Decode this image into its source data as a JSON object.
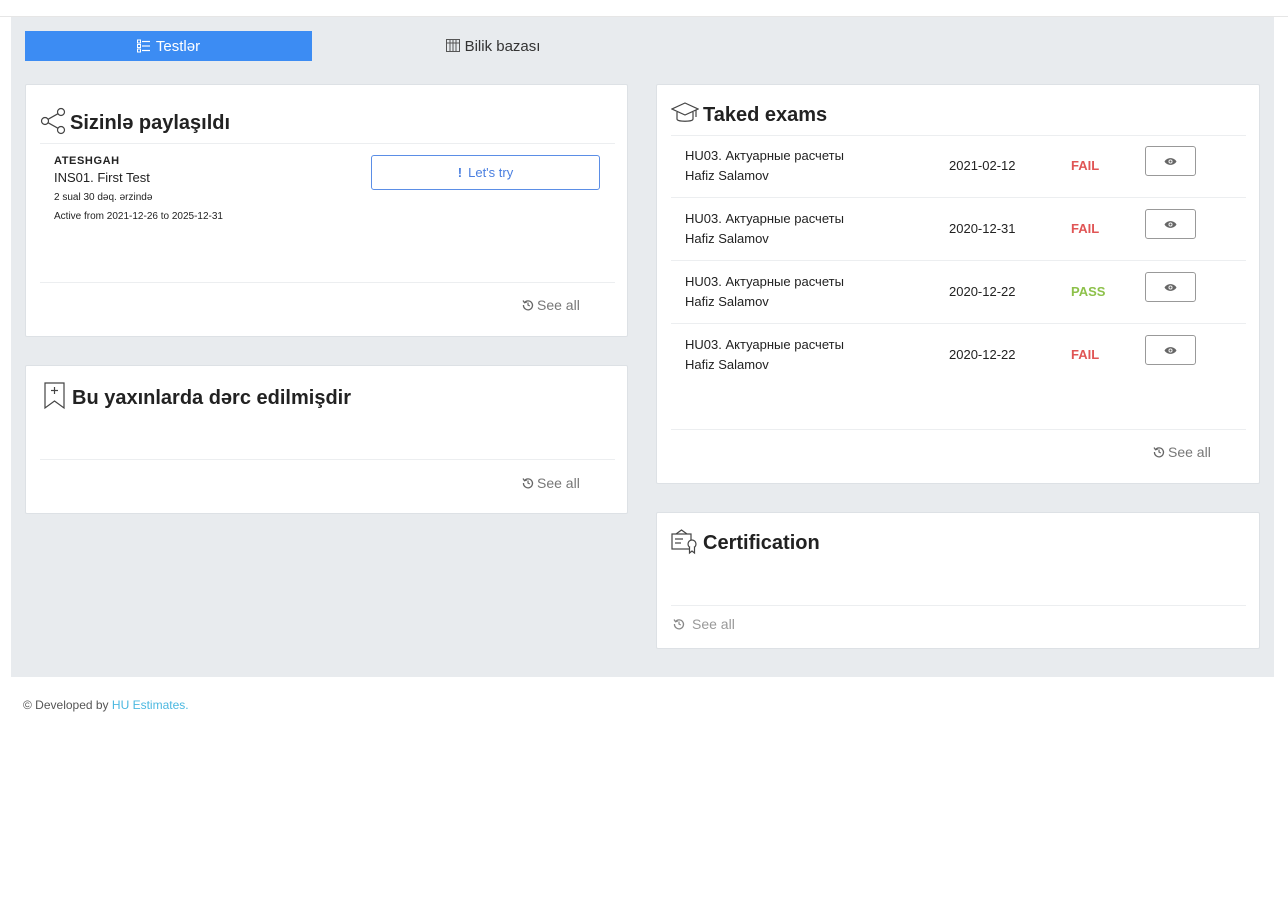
{
  "tabs": [
    {
      "label": "Testlər",
      "icon": "list-icon",
      "active": true
    },
    {
      "label": "Bilik bazası",
      "icon": "library-icon",
      "active": false
    }
  ],
  "shared": {
    "title": "Sizinlə paylaşıldı",
    "icon": "share-icon",
    "item": {
      "org": "ATESHGAH",
      "name": "INS01. First Test",
      "meta": "2 sual 30 dəq. ərzində",
      "active": "Active from 2021-12-26 to 2025-12-31",
      "button": "Let's try"
    },
    "see_all": "See all"
  },
  "recent": {
    "title": "Bu yaxınlarda dərc edilmişdir",
    "icon": "bookmark-plus-icon",
    "see_all": "See all"
  },
  "exams": {
    "title": "Taked exams",
    "icon": "graduation-cap-icon",
    "rows": [
      {
        "name": "HU03. Актуарные расчеты",
        "user": "Hafiz Salamov",
        "date": "2021-02-12",
        "status": "FAIL"
      },
      {
        "name": "HU03. Актуарные расчеты",
        "user": "Hafiz Salamov",
        "date": "2020-12-31",
        "status": "FAIL"
      },
      {
        "name": "HU03. Актуарные расчеты",
        "user": "Hafiz Salamov",
        "date": "2020-12-22",
        "status": "PASS"
      },
      {
        "name": "HU03. Актуарные расчеты",
        "user": "Hafiz Salamov",
        "date": "2020-12-22",
        "status": "FAIL"
      }
    ],
    "see_all": "See all"
  },
  "certification": {
    "title": "Certification",
    "icon": "certificate-icon",
    "see_all": "See all"
  },
  "footer": {
    "prefix": "© Developed by ",
    "link": "HU Estimates."
  },
  "colors": {
    "accent": "#3c8cf3",
    "fail": "#e05555",
    "pass": "#8dc14a",
    "link": "#4bb8e0"
  }
}
